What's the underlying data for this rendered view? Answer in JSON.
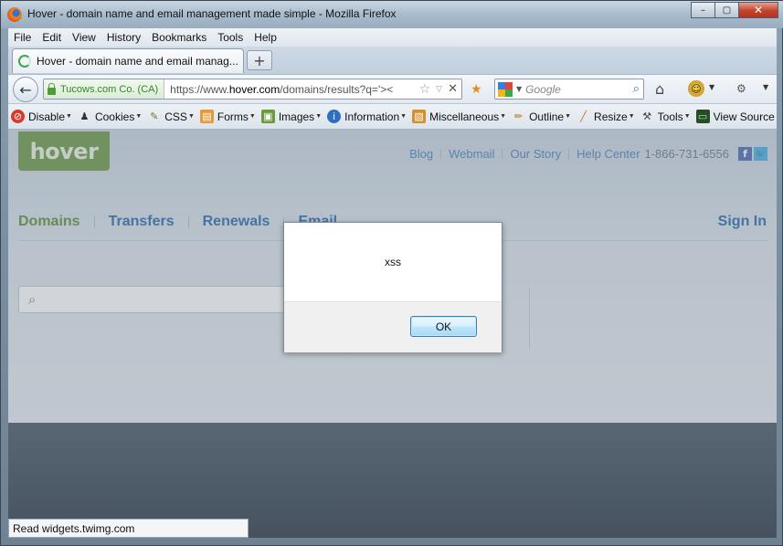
{
  "window": {
    "title": "Hover - domain name and email management made simple - Mozilla Firefox",
    "controls": {
      "minimize": "–",
      "maximize": "▢",
      "close": "✕"
    }
  },
  "menubar": [
    "File",
    "Edit",
    "View",
    "History",
    "Bookmarks",
    "Tools",
    "Help"
  ],
  "tab": {
    "label": "Hover - domain name and email manag...",
    "new_tab": "+"
  },
  "navbar": {
    "identity": "Tucows.com Co. (CA)",
    "url_prefix": "https://www.",
    "url_domain": "hover.com",
    "url_path": "/domains/results?q='><",
    "search_placeholder": "Google"
  },
  "devbar": [
    {
      "label": "Disable",
      "icon": "disable-icon"
    },
    {
      "label": "Cookies",
      "icon": "cookies-icon"
    },
    {
      "label": "CSS",
      "icon": "css-icon"
    },
    {
      "label": "Forms",
      "icon": "forms-icon"
    },
    {
      "label": "Images",
      "icon": "images-icon"
    },
    {
      "label": "Information",
      "icon": "information-icon"
    },
    {
      "label": "Miscellaneous",
      "icon": "miscellaneous-icon"
    },
    {
      "label": "Outline",
      "icon": "outline-icon"
    },
    {
      "label": "Resize",
      "icon": "resize-icon"
    },
    {
      "label": "Tools",
      "icon": "tools-icon"
    },
    {
      "label": "View Source",
      "icon": "view-source-icon"
    }
  ],
  "site": {
    "logo": "hover",
    "toplinks": [
      "Blog",
      "Webmail",
      "Our Story",
      "Help Center"
    ],
    "phone": "1-866-731-6556",
    "nav": [
      "Domains",
      "Transfers",
      "Renewals",
      "Email"
    ],
    "signin": "Sign In"
  },
  "alert": {
    "message": "xss",
    "ok": "OK"
  },
  "status": "Read widgets.twimg.com",
  "colors": {
    "hover_green": "#7aa258",
    "link_blue": "#5a8ec6",
    "nav_active": "#6f9a48"
  }
}
